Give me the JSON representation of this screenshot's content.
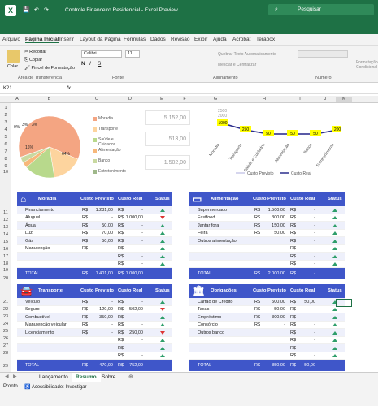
{
  "window": {
    "title": "Controle Financeiro Residencial - Excel Preview",
    "search_placeholder": "Pesquisar"
  },
  "tabs": [
    "Arquivo",
    "Página Inicial",
    "Inserir",
    "Layout da Página",
    "Fórmulas",
    "Dados",
    "Revisão",
    "Exibir",
    "Ajuda",
    "Acrobat",
    "Terabox"
  ],
  "ribbon": {
    "paste": "Colar",
    "cut": "Recortar",
    "copy": "Copiar",
    "painter": "Pincel de Formatação",
    "clipboard": "Área de Transferência",
    "font": "Calibri",
    "size": "11",
    "font_group": "Fonte",
    "wrap": "Quebrar Texto Automaticamente",
    "merge": "Mesclar e Centralizar",
    "align_group": "Alinhamento",
    "number_group": "Número",
    "cond": "Formatação Condicional"
  },
  "formula": {
    "cell": "K21",
    "fx": "fx"
  },
  "columns": [
    "A",
    "B",
    "C",
    "D",
    "E",
    "F",
    "G",
    "H",
    "I",
    "J",
    "K"
  ],
  "rows": [
    "1",
    "2",
    "3",
    "4",
    "5",
    "6",
    "7",
    "8",
    "9",
    "10",
    "11",
    "12",
    "13",
    "14",
    "15",
    "16",
    "17",
    "18",
    "19",
    "20",
    "21",
    "22",
    "23",
    "24",
    "25",
    "26",
    "27",
    "28",
    "29"
  ],
  "pie": {
    "labels": [
      "0%",
      "3%",
      "3%",
      "16%",
      "16%",
      "64%"
    ],
    "legend": [
      "Moradia",
      "Transporte",
      "Saúde e Cuidados",
      "Alimentação",
      "Banco",
      "Entretenimento"
    ],
    "colors": [
      "#f4a582",
      "#fdd49e",
      "#b8d98c",
      "#f7b87a",
      "#c9d9a0",
      "#9fb88a"
    ]
  },
  "boxes": [
    "5.152,00",
    "513,00",
    "1.502,00"
  ],
  "chart_data": {
    "type": "line",
    "categories": [
      "Moradia",
      "Transporte",
      "Saúde e Cuidados",
      "Alimentação",
      "Banco",
      "Entretenimento"
    ],
    "series": [
      {
        "name": "Custo Previsto",
        "values": [
          1000,
          250,
          50,
          50,
          50,
          200
        ]
      },
      {
        "name": "Custo Real",
        "values": [
          1000,
          250,
          50,
          50,
          50,
          200
        ]
      }
    ],
    "yticks": [
      "2500",
      "2000",
      "1500"
    ],
    "point_labels": [
      "1000",
      "250",
      "50",
      "50",
      "50",
      "200"
    ]
  },
  "sections": [
    {
      "title": "Moradia",
      "icon": "house-icon",
      "cp": "Custo Previsto",
      "cr": "Custo Real",
      "st": "Status",
      "rows": [
        [
          "Financiamento",
          "R$",
          "1.231,00",
          "R$",
          "-",
          "up"
        ],
        [
          "Aluguel",
          "R$",
          "-",
          "R$",
          "1.000,00",
          "down"
        ],
        [
          "Água",
          "R$",
          "50,00",
          "R$",
          "-",
          "up"
        ],
        [
          "Luz",
          "R$",
          "70,00",
          "R$",
          "-",
          "up"
        ],
        [
          "Gás",
          "R$",
          "50,00",
          "R$",
          "-",
          "up"
        ],
        [
          "Manutenção",
          "R$",
          "-",
          "R$",
          "-",
          "up"
        ],
        [
          "",
          "",
          "",
          "R$",
          "-",
          "up"
        ],
        [
          "",
          "",
          "",
          "R$",
          "-",
          "up"
        ]
      ],
      "total": [
        "TOTAL",
        "R$",
        "1.401,00",
        "R$",
        "1.000,00"
      ]
    },
    {
      "title": "Alimentação",
      "icon": "monitor-icon",
      "cp": "Custo Previsto",
      "cr": "Custo Real",
      "st": "Status",
      "rows": [
        [
          "Supermercado",
          "R$",
          "1.500,00",
          "R$",
          "-",
          "up"
        ],
        [
          "Fastfood",
          "R$",
          "300,00",
          "R$",
          "-",
          "up"
        ],
        [
          "Jantar fora",
          "R$",
          "150,00",
          "R$",
          "-",
          "up"
        ],
        [
          "Feira",
          "R$",
          "50,00",
          "R$",
          "-",
          "up"
        ],
        [
          "Outros alimentação",
          "",
          "",
          "R$",
          "-",
          "up"
        ],
        [
          "",
          "",
          "",
          "R$",
          "-",
          "up"
        ],
        [
          "",
          "",
          "",
          "R$",
          "-",
          "up"
        ],
        [
          "",
          "",
          "",
          "R$",
          "-",
          "up"
        ]
      ],
      "total": [
        "TOTAL",
        "R$",
        "2.000,00",
        "R$",
        "-"
      ]
    },
    {
      "title": "Transporte",
      "icon": "car-icon",
      "cp": "Custo Previsto",
      "cr": "Custo Real",
      "st": "Status",
      "rows": [
        [
          "Veículo",
          "R$",
          "-",
          "R$",
          "-",
          "up"
        ],
        [
          "Seguro",
          "R$",
          "120,00",
          "R$",
          "502,00",
          "down"
        ],
        [
          "Combustível",
          "R$",
          "350,00",
          "R$",
          "-",
          "up"
        ],
        [
          "Manutenção veicular",
          "R$",
          "-",
          "R$",
          "-",
          "up"
        ],
        [
          "Licenciamento",
          "R$",
          "-",
          "R$",
          "250,00",
          "down"
        ],
        [
          "",
          "",
          "",
          "R$",
          "-",
          "up"
        ],
        [
          "",
          "",
          "",
          "R$",
          "-",
          "up"
        ],
        [
          "",
          "",
          "",
          "R$",
          "-",
          "up"
        ]
      ],
      "total": [
        "TOTAL",
        "R$",
        "470,00",
        "R$",
        "752,00"
      ]
    },
    {
      "title": "Obrigações",
      "icon": "bank-icon",
      "cp": "Custo Previsto",
      "cr": "Custo Real",
      "st": "Status",
      "rows": [
        [
          "Cartão de Crédito",
          "R$",
          "500,00",
          "R$",
          "50,00",
          "up"
        ],
        [
          "Taxas",
          "R$",
          "50,00",
          "R$",
          "-",
          "up"
        ],
        [
          "Empréstimo",
          "R$",
          "300,00",
          "R$",
          "-",
          "up"
        ],
        [
          "Consórcio",
          "R$",
          "-",
          "R$",
          "-",
          "up"
        ],
        [
          "Outros banco",
          "",
          "",
          "R$",
          "-",
          "up"
        ],
        [
          "",
          "",
          "",
          "R$",
          "-",
          "up"
        ],
        [
          "",
          "",
          "",
          "R$",
          "-",
          "up"
        ],
        [
          "",
          "",
          "",
          "R$",
          "-",
          "up"
        ]
      ],
      "total": [
        "TOTAL",
        "R$",
        "850,00",
        "R$",
        "50,00"
      ]
    }
  ],
  "sheets": [
    "Lançamento",
    "Resumo",
    "Sobre"
  ],
  "status": {
    "ready": "Pronto",
    "access": "Acessibilidade: Investigar"
  }
}
